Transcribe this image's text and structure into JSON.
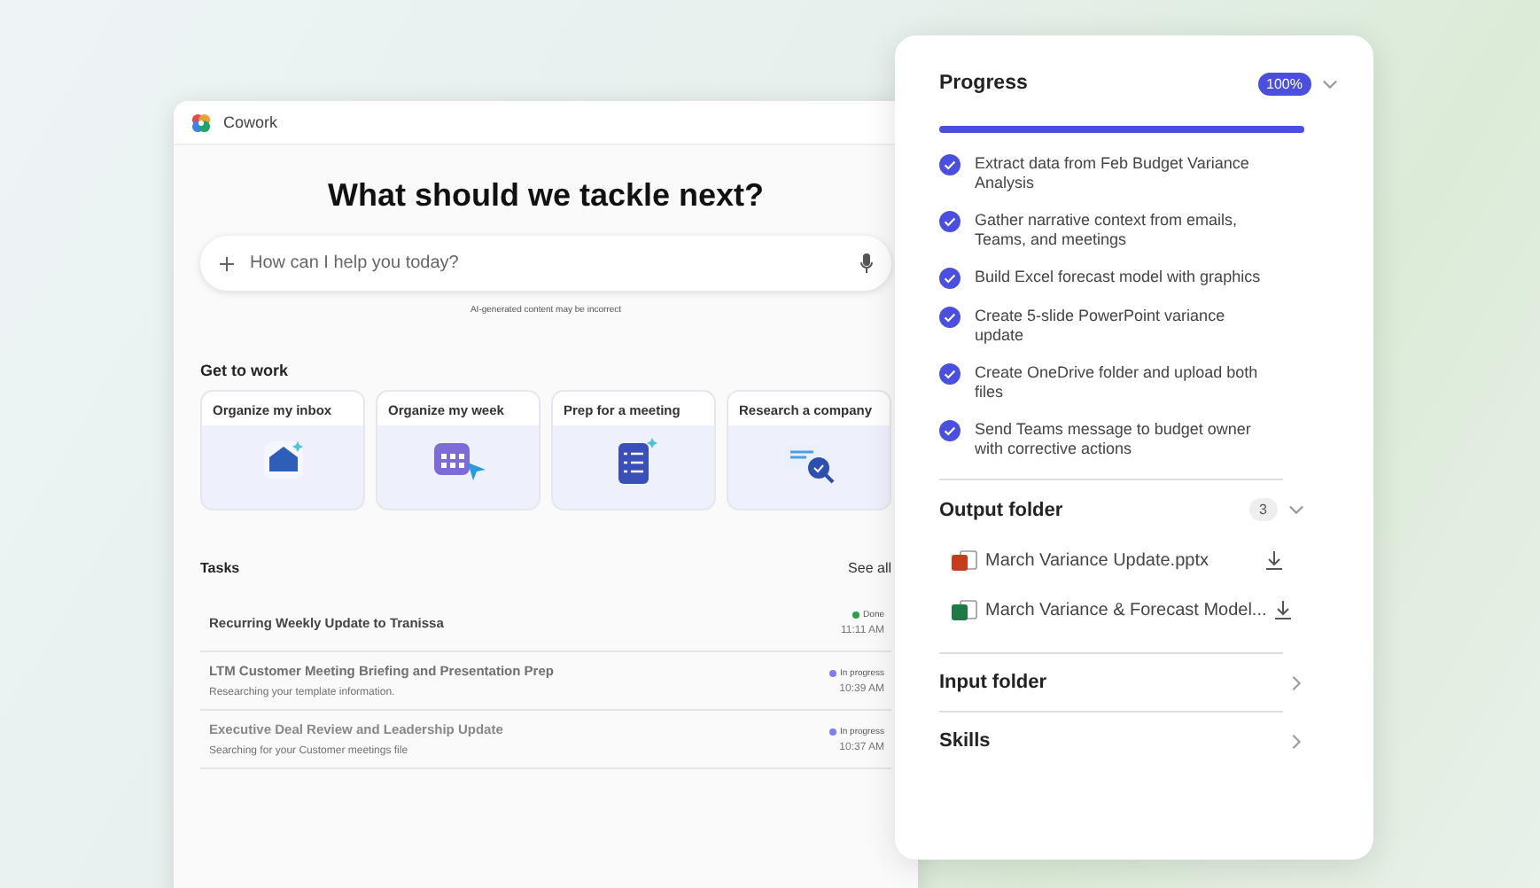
{
  "app_window": {
    "title": "Cowork",
    "heading": "What should we tackle next?",
    "prompt": {
      "placeholder": "How can I help you today?"
    },
    "disclaimer": "AI-generated content may be incorrect",
    "get_to_work": {
      "title": "Get to work",
      "cards": [
        {
          "label": "Organize my inbox"
        },
        {
          "label": "Organize my week"
        },
        {
          "label": "Prep for a meeting"
        },
        {
          "label": "Research a company"
        }
      ]
    },
    "tasks": {
      "title": "Tasks",
      "see_all": "See all",
      "items": [
        {
          "title": "Recurring Weekly Update to Tranissa",
          "status": "Done",
          "color": "#2e9e4a",
          "time": "11:11 AM"
        },
        {
          "title": "LTM Customer Meeting Briefing and Presentation Prep",
          "subtitle": "Researching your template information.",
          "status": "In progress",
          "color": "#7b7ff0",
          "time": "10:39 AM"
        },
        {
          "title": "Executive Deal Review and Leadership Update",
          "subtitle": "Searching for your Customer meetings file",
          "status": "In progress",
          "color": "#7b7ff0",
          "time": "10:37 AM"
        }
      ]
    }
  },
  "panel": {
    "progress": {
      "title": "Progress",
      "badge": "100%",
      "expanded": true,
      "level": 1,
      "steps": [
        {
          "text": "Extract data from Feb Budget Variance Analysis",
          "checked": true
        },
        {
          "text": "Gather narrative context from emails, Teams, and meetings",
          "checked": true
        },
        {
          "text": "Build Excel forecast model with graphics",
          "checked": true
        },
        {
          "text": "Create 5-slide PowerPoint variance update",
          "checked": true
        },
        {
          "text": "Create OneDrive folder and upload both files",
          "checked": true
        },
        {
          "text": "Send Teams message to budget owner with corrective actions",
          "checked": true
        }
      ]
    },
    "sections": [
      {
        "title": "Output folder",
        "count": "3",
        "expanded": true,
        "files": [
          {
            "name": "March Variance Update.pptx",
            "kind": "pptx"
          },
          {
            "name": "March Variance & Forecast Model...",
            "kind": "xlsx"
          }
        ]
      },
      {
        "title": "Input folder",
        "expanded": false
      },
      {
        "title": "Skills",
        "expanded": false
      }
    ]
  }
}
